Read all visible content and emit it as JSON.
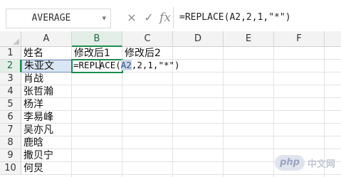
{
  "formula_bar": {
    "name_box": "AVERAGE",
    "cancel_icon": "×",
    "enter_icon": "✓",
    "fx_label": "fx",
    "formula": "=REPLACE(A2,2,1,\"*\")"
  },
  "columns": [
    "A",
    "B",
    "C",
    "D",
    "E",
    "F"
  ],
  "rows": [
    "1",
    "2",
    "3",
    "4",
    "5",
    "6",
    "7",
    "8",
    "9",
    "10"
  ],
  "cells": {
    "A1": "姓名",
    "B1": "修改后1",
    "C1": "修改后2",
    "A2": "朱亚文",
    "A3": "肖战",
    "A4": "张哲瀚",
    "A5": "杨洋",
    "A6": "李易峰",
    "A7": "吴亦凡",
    "A8": "鹿晗",
    "A9": "撒贝宁",
    "A10": "何炅"
  },
  "edit_cell": {
    "pre_caret": "=REPL",
    "post_caret": "ACE(",
    "ref": "A2",
    "rest": ",2,1,\"*\")"
  },
  "watermark": {
    "logo": "php",
    "text": "中文网"
  }
}
